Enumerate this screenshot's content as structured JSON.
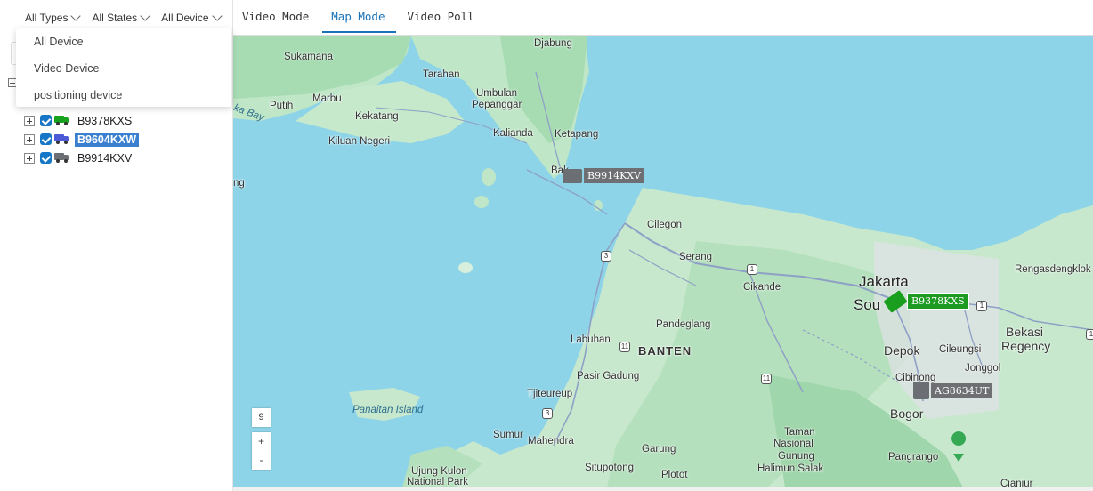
{
  "filters": {
    "types": "All Types",
    "states": "All States",
    "devices": "All Device"
  },
  "device_dropdown": {
    "options": [
      "All Device",
      "Video Device",
      "positioning device"
    ]
  },
  "tree": {
    "vehicles": [
      {
        "plate": "B9378KXS",
        "color": "#17a21e",
        "selected": false
      },
      {
        "plate": "B9604KXW",
        "color": "#4d5bd6",
        "selected": true
      },
      {
        "plate": "B9914KXV",
        "color": "#6c6f73",
        "selected": false
      }
    ]
  },
  "tabs": [
    "Video Mode",
    "Map Mode",
    "Video Poll"
  ],
  "active_tab": "Map Mode",
  "map": {
    "zoom": "9",
    "zoom_in": "+",
    "zoom_out": "-",
    "labels": {
      "sukamana": "Sukamana",
      "djabung": "Djabung",
      "tarahan": "Tarahan",
      "marbu": "Marbu",
      "umbulan": "Umbulan",
      "pepanggar": "Pepanggar",
      "putih": "Putih",
      "kekatang": "Kekatang",
      "ka_bay": "ka Bay",
      "kalianda": "Kalianda",
      "ketapang": "Ketapang",
      "kiluan": "Kiluan Negeri",
      "ng": "ng",
      "bak": "Bak",
      "cilegon": "Cilegon",
      "serang": "Serang",
      "cikande": "Cikande",
      "jakarta": "Jakarta",
      "south": "Sou",
      "rengasdengklok": "Rengasdengklok",
      "bekasi": "Bekasi",
      "regency": "Regency",
      "depok": "Depok",
      "cileungsi": "Cileungsi",
      "jonggol": "Jonggol",
      "cibinong": "Cibinong",
      "bogor": "Bogor",
      "pandeglang": "Pandeglang",
      "labuhan": "Labuhan",
      "banten": "BANTEN",
      "pasir_gadung": "Pasir Gadung",
      "tjiteureup": "Tjiteureup",
      "panaitan": "Panaitan Island",
      "sumur": "Sumur",
      "mahendra": "Mahendra",
      "garung": "Garung",
      "taman": "Taman",
      "nasional": "Nasional",
      "gunung": "Gunung",
      "halimun": "Halimun Salak",
      "pangrango": "Pangrango",
      "situpotong": "Situpotong",
      "plotot": "Plotot",
      "ujung_kulon": "Ujung Kulon",
      "national_park": "National Park",
      "cianjur": "Cianjur"
    },
    "shields": [
      "3",
      "1",
      "1",
      "11",
      "11",
      "3",
      "1"
    ],
    "vehicles": [
      {
        "plate": "B9914KXV",
        "color": "#6d6f72"
      },
      {
        "plate": "B9378KXS",
        "color": "#1c9a22"
      },
      {
        "plate": "AG8634UT",
        "color": "#6d6f72"
      }
    ]
  }
}
